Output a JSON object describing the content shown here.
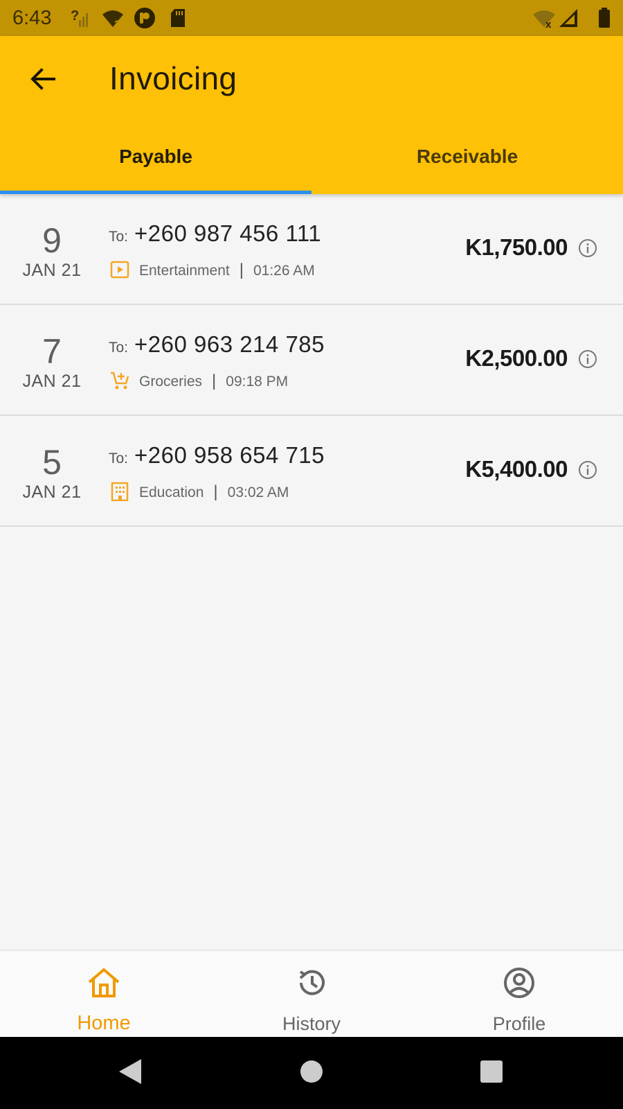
{
  "status_bar": {
    "time": "6:43",
    "icons": [
      "signal-unknown-icon",
      "wifi-unknown-icon",
      "app-notification-icon",
      "sd-card-icon",
      "wifi-off-icon",
      "cell-signal-icon",
      "battery-icon"
    ]
  },
  "app_bar": {
    "title": "Invoicing",
    "back_icon": "arrow-left-icon",
    "background": "#ffc107"
  },
  "tabs": [
    {
      "label": "Payable",
      "selected": true
    },
    {
      "label": "Receivable",
      "selected": false
    }
  ],
  "accent": "#2b8ff0",
  "invoices": [
    {
      "day": "9",
      "month": "JAN 21",
      "to_label": "To:",
      "phone": "+260 987 456 111",
      "category": "Entertainment",
      "category_icon": "play-box-icon",
      "separator": "|",
      "time": "01:26 AM",
      "amount": "K1,750.00"
    },
    {
      "day": "7",
      "month": "JAN 21",
      "to_label": "To:",
      "phone": "+260 963 214 785",
      "category": "Groceries",
      "category_icon": "add-shopping-cart-icon",
      "separator": "|",
      "time": "09:18 PM",
      "amount": "K2,500.00"
    },
    {
      "day": "5",
      "month": "JAN 21",
      "to_label": "To:",
      "phone": "+260 958 654 715",
      "category": "Education",
      "category_icon": "building-icon",
      "separator": "|",
      "time": "03:02 AM",
      "amount": "K5,400.00"
    }
  ],
  "category_icon_color": "#f5a623",
  "bottom_nav": [
    {
      "label": "Home",
      "icon": "home-icon",
      "active": true
    },
    {
      "label": "History",
      "icon": "history-icon",
      "active": false
    },
    {
      "label": "Profile",
      "icon": "account-circle-icon",
      "active": false
    }
  ]
}
